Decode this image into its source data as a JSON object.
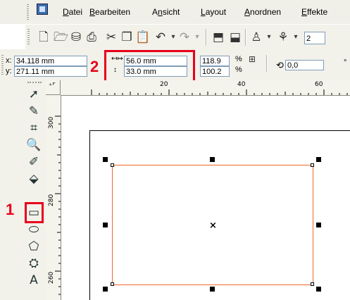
{
  "menu": {
    "items": [
      {
        "label": "Datei",
        "u": "D"
      },
      {
        "label": "Bearbeiten",
        "u": "B"
      },
      {
        "label": "Ansicht",
        "u": "n"
      },
      {
        "label": "Layout",
        "u": "L"
      },
      {
        "label": "Anordnen",
        "u": "A"
      },
      {
        "label": "Effekte",
        "u": "E"
      }
    ]
  },
  "toolbar": {
    "icons": [
      "new-icon",
      "open-icon",
      "save-icon",
      "print-icon",
      "cut-icon",
      "copy-icon",
      "paste-icon",
      "undo-icon",
      "redo-icon",
      "import-icon",
      "export-icon",
      "app-launcher-icon",
      "zoom-level-icon"
    ],
    "zoom_partial": "2"
  },
  "propbar": {
    "x_label": "x:",
    "x_value": "34.118 mm",
    "y_label": "y:",
    "y_value": "271.11 mm",
    "width_value": "56.0 mm",
    "height_value": "33.0 mm",
    "scale_x": "118.9",
    "scale_y": "100.2",
    "percent": "%",
    "rotation": "0,0",
    "degree": "°"
  },
  "callouts": {
    "one": "1",
    "two": "2"
  },
  "rulers": {
    "h_ticks": [
      "20",
      "40",
      "60"
    ],
    "v_ticks": [
      "300",
      "280",
      "260"
    ]
  },
  "colors": {
    "highlight": "#e8001c",
    "outline": "#f06a2a"
  }
}
